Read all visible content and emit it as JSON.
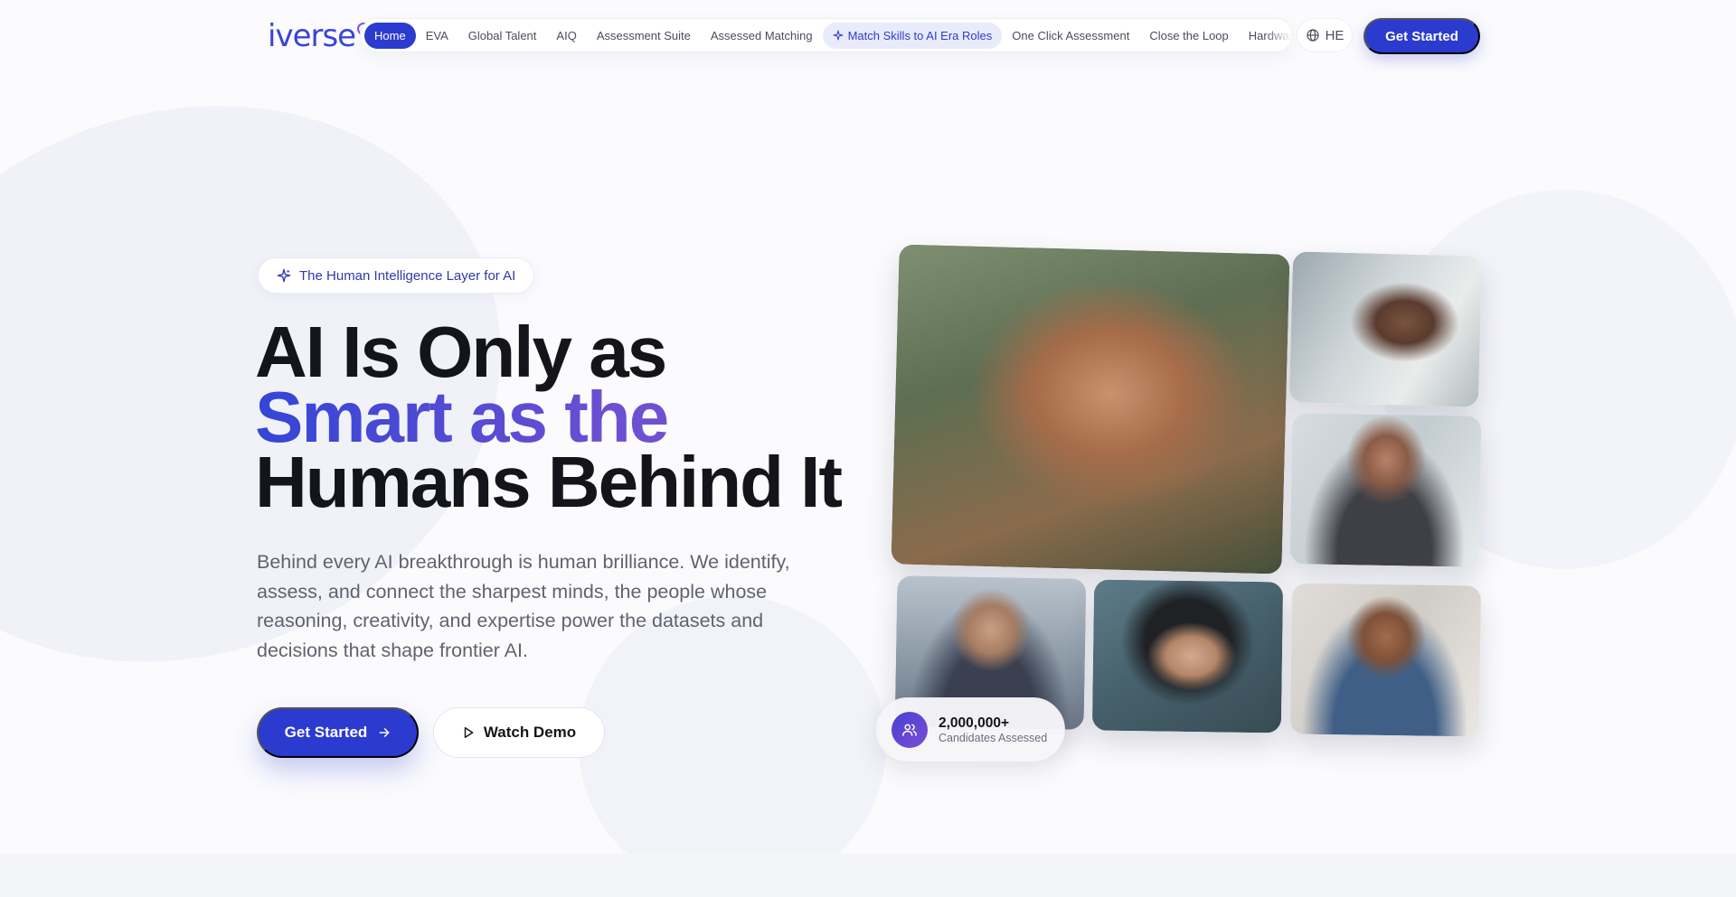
{
  "brand": {
    "logo_text": "iverse",
    "accent": "#2b3bcf",
    "gradient": [
      "#3346d6",
      "#7d55cf"
    ]
  },
  "nav": {
    "items": [
      {
        "label": "Home",
        "active": true
      },
      {
        "label": "EVA"
      },
      {
        "label": "Global Talent"
      },
      {
        "label": "AIQ"
      },
      {
        "label": "Assessment Suite"
      },
      {
        "label": "Assessed Matching"
      },
      {
        "label": "Match Skills to AI Era Roles",
        "icon": "sparkle-icon",
        "highlighted": true
      },
      {
        "label": "One Click Assessment"
      },
      {
        "label": "Close the Loop"
      },
      {
        "label": "Hardware Talent"
      }
    ],
    "language": {
      "icon": "globe-icon",
      "label": "HE"
    },
    "cta_label": "Get Started"
  },
  "hero": {
    "badge": {
      "icon": "sparkle-icon",
      "label": "The Human Intelligence Layer for AI"
    },
    "headline": {
      "line1": "AI Is Only as",
      "line2": "Smart as the",
      "line3": "Humans Behind It"
    },
    "subtitle": "Behind every AI breakthrough is human brilliance. We identify, assess, and connect the sharpest minds, the people whose reasoning, creativity, and expertise power the datasets and decisions that shape frontier AI.",
    "primary_cta": {
      "label": "Get Started",
      "icon": "arrow-right-icon"
    },
    "secondary_cta": {
      "label": "Watch Demo",
      "icon": "play-icon"
    }
  },
  "stat": {
    "icon": "users-icon",
    "value": "2,000,000+",
    "label": "Candidates Assessed"
  }
}
